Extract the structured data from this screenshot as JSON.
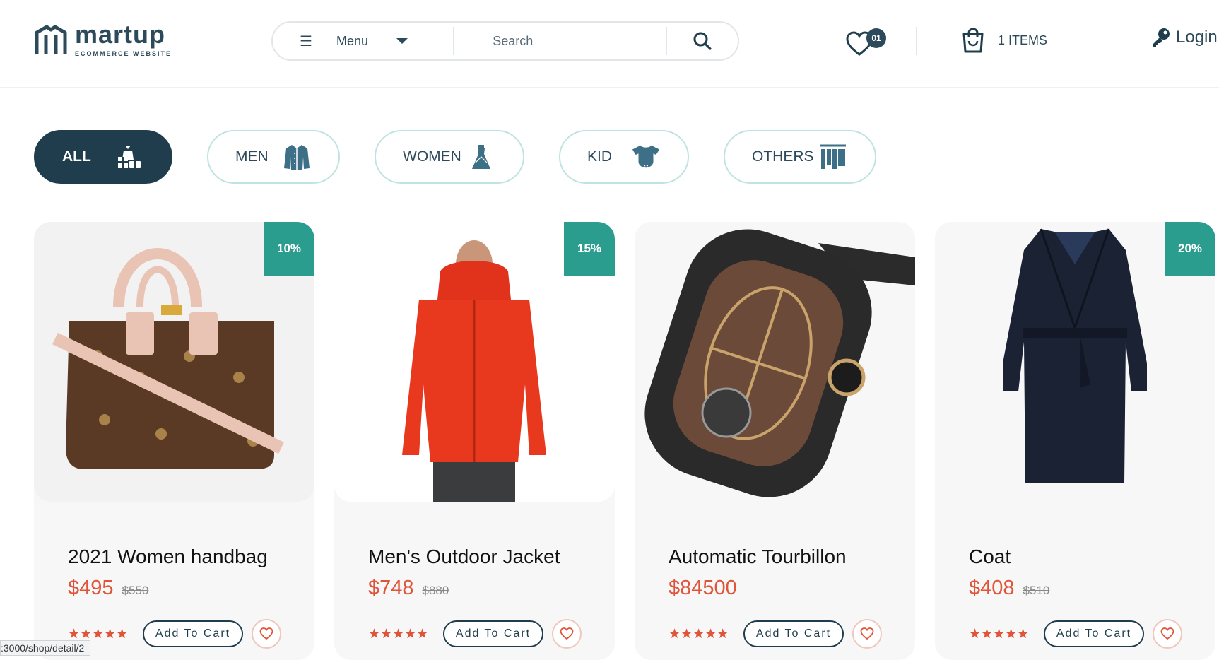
{
  "brand": {
    "name": "martup",
    "tagline": "ECOMMERCE WEBSITE"
  },
  "search": {
    "menu_label": "Menu",
    "placeholder": "Search"
  },
  "wishlist": {
    "count": "01"
  },
  "cart": {
    "label": "1 ITEMS"
  },
  "login": {
    "label": "Login"
  },
  "categories": [
    {
      "label": "ALL",
      "icon": "gift-shopping-icon",
      "active": true
    },
    {
      "label": "MEN",
      "icon": "jacket-icon"
    },
    {
      "label": "WOMEN",
      "icon": "dress-icon"
    },
    {
      "label": "KID",
      "icon": "baby-bodysuit-icon"
    },
    {
      "label": "OTHERS",
      "icon": "clothes-rack-icon"
    }
  ],
  "products": [
    {
      "title": "2021 Women handbag",
      "price": "$495",
      "old_price": "$550",
      "discount": "10%",
      "rating": 5,
      "image": "handbag"
    },
    {
      "title": "Men's Outdoor Jacket",
      "price": "$748",
      "old_price": "$880",
      "discount": "15%",
      "rating": 5,
      "image": "red-jacket"
    },
    {
      "title": "Automatic Tourbillon",
      "price": "$84500",
      "old_price": "",
      "discount": "",
      "rating": 5,
      "image": "watch"
    },
    {
      "title": "Coat",
      "price": "$408",
      "old_price": "$510",
      "discount": "20%",
      "rating": 5,
      "image": "navy-coat"
    }
  ],
  "product_ui": {
    "add_to_cart": "Add To Cart",
    "stars": "★★★★★"
  },
  "colors": {
    "brand": "#1f3d4c",
    "accent": "#e0543a",
    "discount": "#2a9d8f",
    "category_border": "#bfe3e1"
  },
  "status_bar": {
    "url": ":3000/shop/detail/2"
  }
}
